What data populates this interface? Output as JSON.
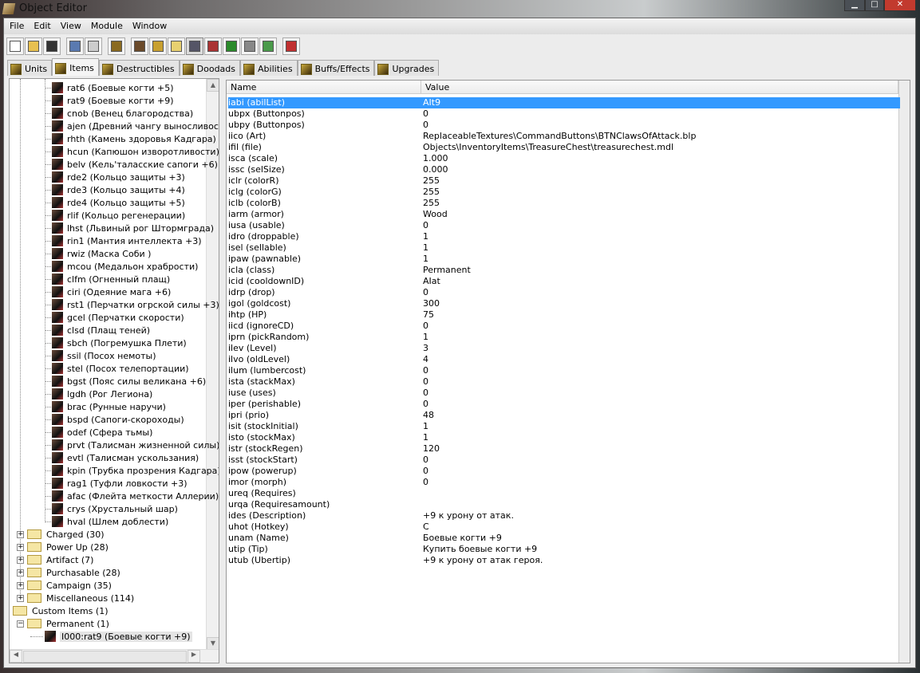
{
  "window": {
    "title": "Object Editor"
  },
  "menu": [
    "File",
    "Edit",
    "View",
    "Module",
    "Window"
  ],
  "toolbar": [
    "new-icon",
    "open-icon",
    "save-icon",
    "copy-icon",
    "paste-icon",
    "item-chest-icon",
    "terrain-icon",
    "text-a-icon",
    "sound-icon",
    "unit-icon",
    "ui-icon",
    "monster-icon",
    "cube-icon",
    "export-icon",
    "checklist-icon"
  ],
  "tabs": [
    {
      "label": "Units"
    },
    {
      "label": "Items",
      "active": true
    },
    {
      "label": "Destructibles"
    },
    {
      "label": "Doodads"
    },
    {
      "label": "Abilities"
    },
    {
      "label": "Buffs/Effects"
    },
    {
      "label": "Upgrades"
    }
  ],
  "tree": {
    "items": [
      "rat6 (Боевые когти +5)",
      "rat9 (Боевые когти +9)",
      "cnob (Венец благородства)",
      "ajen (Древний чангу выносливости)",
      "rhth (Камень здоровья Кадгара)",
      "hcun (Капюшон изворотливости)",
      "belv (Кель'таласские сапоги +6)",
      "rde2 (Кольцо защиты +3)",
      "rde3 (Кольцо защиты +4)",
      "rde4 (Кольцо защиты +5)",
      "rlif (Кольцо регенерации)",
      "lhst (Львиный рог Штормграда)",
      "rin1 (Мантия интеллекта +3)",
      "rwiz (Маска Соби )",
      "mcou (Медальон храбрости)",
      "clfm (Огненный плащ)",
      "ciri (Одеяние мага +6)",
      "rst1 (Перчатки огрской силы +3)",
      "gcel (Перчатки скорости)",
      "clsd (Плащ теней)",
      "sbch (Погремушка Плети)",
      "ssil (Посох немоты)",
      "stel (Посох телепортации)",
      "bgst (Пояс силы великана +6)",
      "lgdh (Рог Легиона)",
      "brac (Рунные наручи)",
      "bspd (Сапоги-скороходы)",
      "odef (Сфера тьмы)",
      "prvt (Талисман жизненной силы)",
      "evtl (Талисман ускользания)",
      "kpin (Трубка прозрения Кадгара)",
      "rag1 (Туфли ловкости +3)",
      "afac (Флейта меткости Аллерии)",
      "crys (Хрустальный шар)",
      "hval (Шлем доблести)"
    ],
    "folders": [
      "Charged (30)",
      "Power Up (28)",
      "Artifact (7)",
      "Purchasable (28)",
      "Campaign (35)",
      "Miscellaneous (114)"
    ],
    "custom_root": "Custom Items (1)",
    "custom_folder": "Permanent (1)",
    "custom_item": "I000:rat9 (Боевые когти +9)"
  },
  "props": {
    "headers": {
      "name": "Name",
      "value": "Value"
    },
    "selected_index": 0,
    "rows": [
      {
        "n": "iabi (abilList)",
        "v": "AIt9"
      },
      {
        "n": "ubpx (Buttonpos)",
        "v": "0"
      },
      {
        "n": "ubpy (Buttonpos)",
        "v": "0"
      },
      {
        "n": "iico (Art)",
        "v": "ReplaceableTextures\\CommandButtons\\BTNClawsOfAttack.blp"
      },
      {
        "n": "ifil (file)",
        "v": "Objects\\InventoryItems\\TreasureChest\\treasurechest.mdl"
      },
      {
        "n": "isca (scale)",
        "v": "1.000"
      },
      {
        "n": "issc (selSize)",
        "v": "0.000"
      },
      {
        "n": "iclr (colorR)",
        "v": "255"
      },
      {
        "n": "iclg (colorG)",
        "v": "255"
      },
      {
        "n": "iclb (colorB)",
        "v": "255"
      },
      {
        "n": "iarm (armor)",
        "v": "Wood"
      },
      {
        "n": "iusa (usable)",
        "v": "0"
      },
      {
        "n": "idro (droppable)",
        "v": "1"
      },
      {
        "n": "isel (sellable)",
        "v": "1"
      },
      {
        "n": "ipaw (pawnable)",
        "v": "1"
      },
      {
        "n": "icla (class)",
        "v": "Permanent"
      },
      {
        "n": "icid (cooldownID)",
        "v": "AIat"
      },
      {
        "n": "idrp (drop)",
        "v": "0"
      },
      {
        "n": "igol (goldcost)",
        "v": "300"
      },
      {
        "n": "ihtp (HP)",
        "v": "75"
      },
      {
        "n": "iicd (ignoreCD)",
        "v": "0"
      },
      {
        "n": "iprn (pickRandom)",
        "v": "1"
      },
      {
        "n": "ilev (Level)",
        "v": "3"
      },
      {
        "n": "ilvo (oldLevel)",
        "v": "4"
      },
      {
        "n": "ilum (lumbercost)",
        "v": "0"
      },
      {
        "n": "ista (stackMax)",
        "v": "0"
      },
      {
        "n": "iuse (uses)",
        "v": "0"
      },
      {
        "n": "iper (perishable)",
        "v": "0"
      },
      {
        "n": "ipri (prio)",
        "v": "48"
      },
      {
        "n": "isit (stockInitial)",
        "v": "1"
      },
      {
        "n": "isto (stockMax)",
        "v": "1"
      },
      {
        "n": "istr (stockRegen)",
        "v": "120"
      },
      {
        "n": "isst (stockStart)",
        "v": "0"
      },
      {
        "n": "ipow (powerup)",
        "v": "0"
      },
      {
        "n": "imor (morph)",
        "v": "0"
      },
      {
        "n": "ureq (Requires)",
        "v": ""
      },
      {
        "n": "urqa (Requiresamount)",
        "v": ""
      },
      {
        "n": "ides (Description)",
        "v": "+9 к урону от атак."
      },
      {
        "n": "uhot (Hotkey)",
        "v": "C"
      },
      {
        "n": "unam (Name)",
        "v": "Боевые когти +9"
      },
      {
        "n": "utip (Tip)",
        "v": "Купить боевые когти +9"
      },
      {
        "n": "utub (Ubertip)",
        "v": "+9 к урону от атак героя."
      }
    ]
  },
  "colors": {
    "selection": "#3399ff",
    "close_button": "#c23a2e"
  }
}
